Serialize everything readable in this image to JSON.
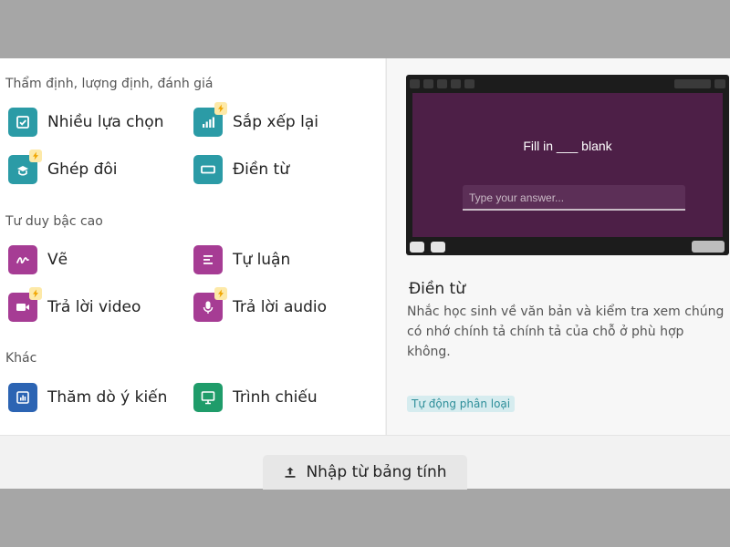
{
  "sections": {
    "assessment": {
      "title": "Thẩm định, lượng định, đánh giá",
      "items": [
        {
          "label": "Nhiều lựa chọn",
          "icon": "checkbox-icon",
          "color": "#2b9ba6",
          "premium": false
        },
        {
          "label": "Sắp xếp lại",
          "icon": "bar-chart-icon",
          "color": "#2b9ba6",
          "premium": true
        },
        {
          "label": "Ghép đôi",
          "icon": "match-icon",
          "color": "#2b9ba6",
          "premium": true
        },
        {
          "label": "Điền từ",
          "icon": "fill-blank-icon",
          "color": "#2b9ba6",
          "premium": false
        }
      ]
    },
    "higher_order": {
      "title": "Tư duy bậc cao",
      "items": [
        {
          "label": "Vẽ",
          "icon": "draw-icon",
          "color": "#a63c94",
          "premium": false
        },
        {
          "label": "Tự luận",
          "icon": "text-lines-icon",
          "color": "#a63c94",
          "premium": false
        },
        {
          "label": "Trả lời video",
          "icon": "video-icon",
          "color": "#a63c94",
          "premium": true
        },
        {
          "label": "Trả lời audio",
          "icon": "microphone-icon",
          "color": "#a63c94",
          "premium": true
        }
      ]
    },
    "other": {
      "title": "Khác",
      "items": [
        {
          "label": "Thăm dò ý kiến",
          "icon": "poll-icon",
          "color": "#2c64b3",
          "premium": false
        },
        {
          "label": "Trình chiếu",
          "icon": "slideshow-icon",
          "color": "#1f9c6a",
          "premium": false
        }
      ]
    }
  },
  "preview": {
    "question": "Fill in ___ blank",
    "answer_placeholder": "Type your answer..."
  },
  "details": {
    "title": "Điền từ",
    "description": "Nhắc học sinh về văn bản và kiểm tra xem chúng có nhớ chính tả chính tả của chỗ ở phù hợp không.",
    "badge": "Tự động phân loại"
  },
  "import_button": {
    "label": "Nhập từ bảng tính",
    "icon": "upload-icon"
  }
}
